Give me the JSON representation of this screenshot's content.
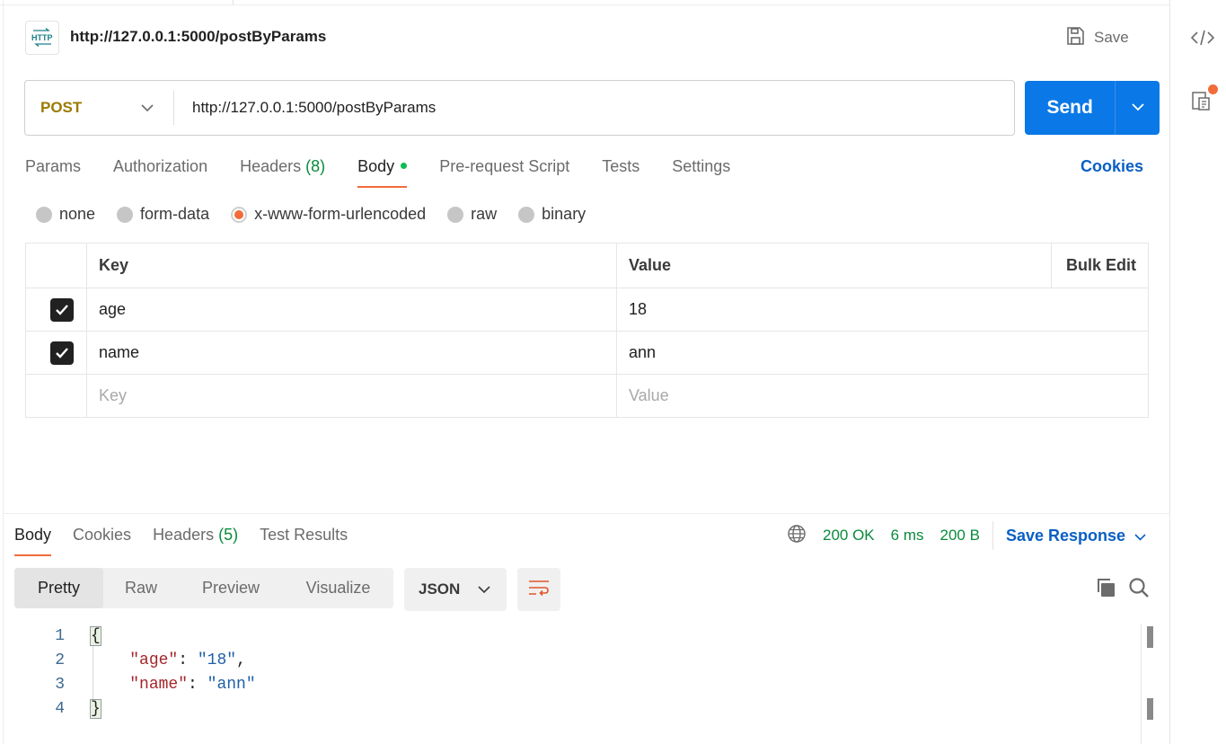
{
  "request": {
    "title": "http://127.0.0.1:5000/postByParams",
    "save_label": "Save",
    "method": "POST",
    "url": "http://127.0.0.1:5000/postByParams",
    "send_label": "Send",
    "tabs": [
      {
        "label": "Params"
      },
      {
        "label": "Authorization"
      },
      {
        "label": "Headers",
        "count": "(8)"
      },
      {
        "label": "Body"
      },
      {
        "label": "Pre-request Script"
      },
      {
        "label": "Tests"
      },
      {
        "label": "Settings"
      }
    ],
    "cookies_label": "Cookies",
    "body_types": [
      "none",
      "form-data",
      "x-www-form-urlencoded",
      "raw",
      "binary"
    ],
    "selected_body_type": "x-www-form-urlencoded",
    "table": {
      "headers": {
        "key": "Key",
        "value": "Value",
        "bulk": "Bulk Edit"
      },
      "rows": [
        {
          "checked": true,
          "key": "age",
          "value": "18"
        },
        {
          "checked": true,
          "key": "name",
          "value": "ann"
        }
      ],
      "placeholder": {
        "key": "Key",
        "value": "Value"
      }
    }
  },
  "response": {
    "tabs": [
      {
        "label": "Body"
      },
      {
        "label": "Cookies"
      },
      {
        "label": "Headers",
        "count": "(5)"
      },
      {
        "label": "Test Results"
      }
    ],
    "status": "200 OK",
    "time": "6 ms",
    "size": "200 B",
    "save_response_label": "Save Response",
    "view_modes": [
      "Pretty",
      "Raw",
      "Preview",
      "Visualize"
    ],
    "active_view": "Pretty",
    "format": "JSON",
    "line_numbers": [
      "1",
      "2",
      "3",
      "4"
    ],
    "json": {
      "open": "{",
      "close": "}",
      "entries": [
        {
          "key": "\"age\"",
          "value": "\"18\"",
          "trail": ","
        },
        {
          "key": "\"name\"",
          "value": "\"ann\"",
          "trail": ""
        }
      ]
    }
  },
  "colors": {
    "accent": "#f26b3a",
    "send": "#0a78e6",
    "method": "#9c7a00",
    "success": "#0b8a3d",
    "link": "#0a5fc4"
  },
  "icons": [
    "http-icon",
    "save-icon",
    "chevron-down-icon",
    "globe-icon",
    "wrap-lines-icon",
    "copy-icon",
    "search-icon",
    "code-icon",
    "documentation-icon"
  ]
}
